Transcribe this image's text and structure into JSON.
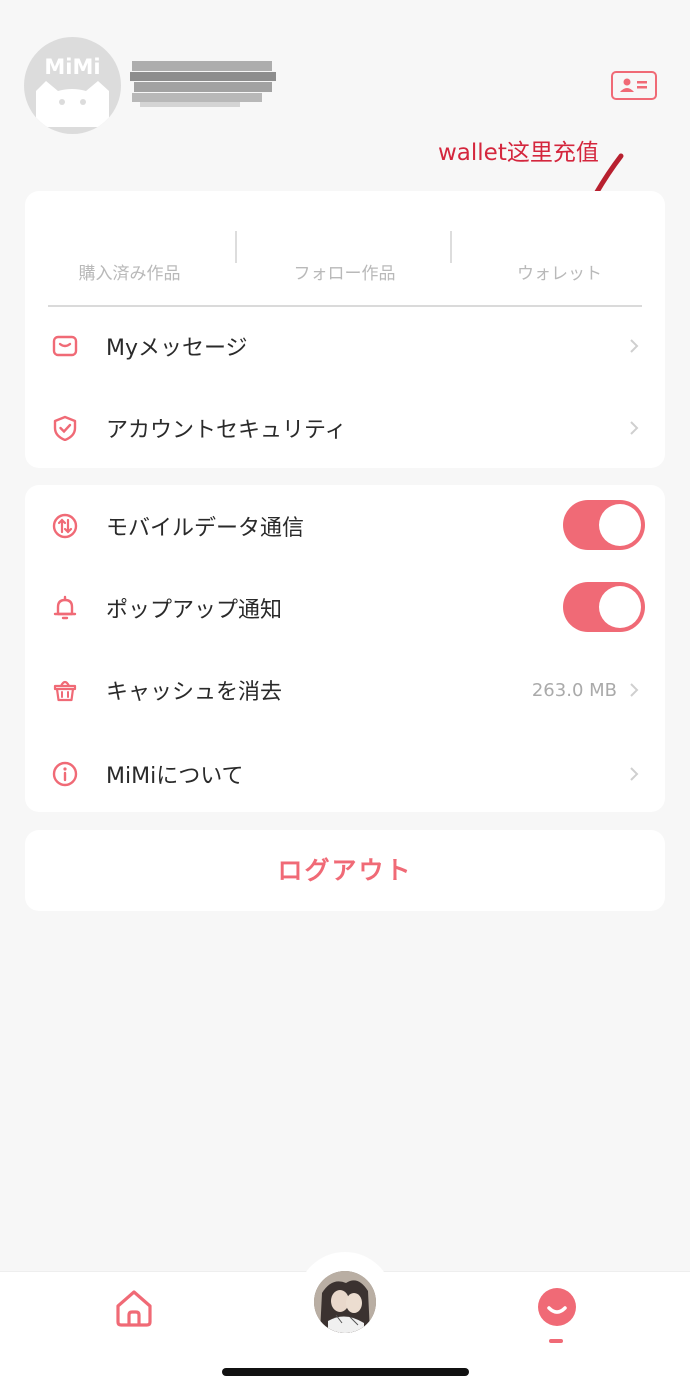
{
  "header": {
    "avatar_brand": "MiMi",
    "id_card_icon": "id-card-icon"
  },
  "annotation": {
    "text": "wallet这里充值"
  },
  "stats": [
    {
      "label": "購入済み作品"
    },
    {
      "label": "フォロー作品"
    },
    {
      "label": "ウォレット"
    }
  ],
  "menu_group_1": [
    {
      "label": "Myメッセージ",
      "icon": "mail-icon"
    },
    {
      "label": "アカウントセキュリティ",
      "icon": "shield-check-icon"
    }
  ],
  "menu_group_2": [
    {
      "label": "モバイルデータ通信",
      "icon": "data-transfer-icon",
      "toggle_on": true
    },
    {
      "label": "ポップアップ通知",
      "icon": "bell-icon",
      "toggle_on": true
    },
    {
      "label": "キャッシュを消去",
      "icon": "basket-icon",
      "value": "263.0 MB"
    },
    {
      "label": "MiMiについて",
      "icon": "info-icon"
    }
  ],
  "logout_label": "ログアウト",
  "tabbar": {
    "tabs": [
      {
        "name": "home",
        "icon": "home-icon"
      },
      {
        "name": "center",
        "icon": "avatar-thumbnail"
      },
      {
        "name": "me",
        "icon": "me-icon",
        "active": true
      }
    ]
  },
  "colors": {
    "accent": "#f06a76",
    "annotation": "#d4263d",
    "background": "#f7f7f7"
  }
}
